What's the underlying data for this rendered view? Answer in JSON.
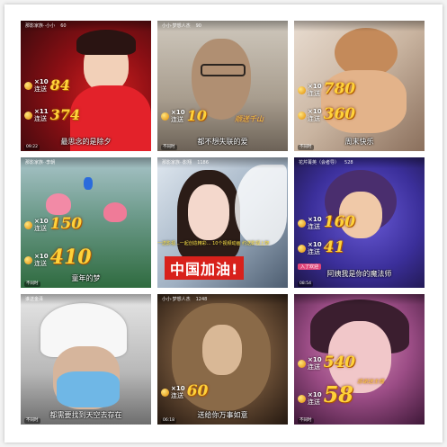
{
  "tiles": [
    {
      "header": "那影家族··小小",
      "count": "60",
      "combos": [
        {
          "x": "×10",
          "big": "84"
        },
        {
          "x": "×11",
          "big": "374"
        }
      ],
      "lian": "连送",
      "caption": "最思念的是除夕",
      "time": "09:22"
    },
    {
      "header": "小小·梦想人杰",
      "count": "90",
      "combos": [
        {
          "x": "×10",
          "big": "10"
        }
      ],
      "lian": "连送",
      "sticker": "顺送千山",
      "caption": "都不想失联的爱",
      "time": "不同时"
    },
    {
      "header": "",
      "count": "",
      "combos": [
        {
          "x": "×10",
          "big": "780"
        },
        {
          "x": "×10",
          "big": "360"
        }
      ],
      "lian": "连送",
      "caption": "周末快乐",
      "time": "不同时"
    },
    {
      "header": "那影家族··李朝",
      "count": "",
      "combos": [
        {
          "x": "×10",
          "big": "150"
        },
        {
          "x": "×10",
          "big": "410"
        }
      ],
      "lian": "连送",
      "caption": "童年的梦",
      "time": "不同时"
    },
    {
      "header": "那影家族··影翔",
      "count": "1186",
      "combos": [],
      "lian": "",
      "banner": "中国加油!",
      "ticker": "一送影视...一起创造精彩... 10个视频动画 约送影视上架",
      "caption": "",
      "time": ""
    },
    {
      "header": "花芹菁英（会者导）",
      "count": "528",
      "combos": [
        {
          "x": "×10",
          "big": "160"
        },
        {
          "x": "×10",
          "big": "41"
        }
      ],
      "lian": "连送",
      "pinktag": "入了欢迎",
      "caption": "阿姨我是你的魔法师",
      "time": "08:54"
    },
    {
      "header": "谁送金泽",
      "count": "",
      "combos": [],
      "lian": "",
      "caption": "都需要找到天空去存在",
      "time": "不同时"
    },
    {
      "header": "小小·梦想人杰",
      "count": "1248",
      "combos": [
        {
          "x": "×10",
          "big": "60"
        }
      ],
      "lian": "连送",
      "caption": "送给你万事如意",
      "time": "06:18"
    },
    {
      "header": "",
      "count": "",
      "combos": [
        {
          "x": "×10",
          "big": "540"
        },
        {
          "x": "×10",
          "big": "58"
        }
      ],
      "lian": "连送",
      "sticker": "感谢送主播",
      "caption": "",
      "time": "不同时"
    }
  ]
}
